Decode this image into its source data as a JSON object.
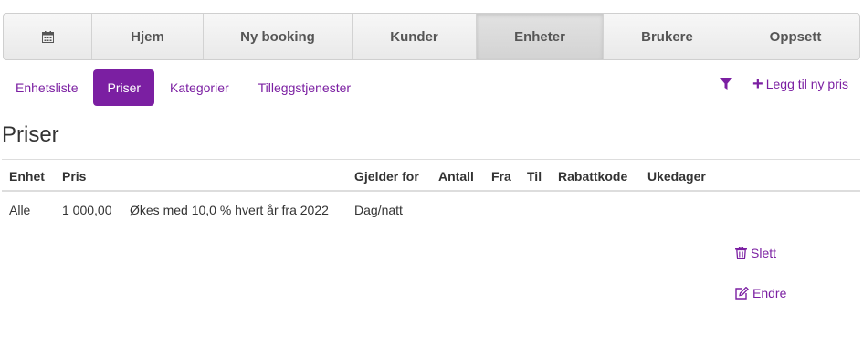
{
  "nav": {
    "items": [
      {
        "label": ""
      },
      {
        "label": "Hjem"
      },
      {
        "label": "Ny booking"
      },
      {
        "label": "Kunder"
      },
      {
        "label": "Enheter"
      },
      {
        "label": "Brukere"
      },
      {
        "label": "Oppsett"
      }
    ],
    "active": "Enheter"
  },
  "subtabs": [
    {
      "label": "Enhetsliste"
    },
    {
      "label": "Priser"
    },
    {
      "label": "Kategorier"
    },
    {
      "label": "Tilleggstjenester"
    }
  ],
  "actions": {
    "filter_icon": "filter-icon",
    "add_label": "Legg til ny pris"
  },
  "page": {
    "title": "Priser"
  },
  "table": {
    "headers": {
      "unit": "Enhet",
      "price": "Pris",
      "applies": "Gjelder for",
      "count": "Antall",
      "from": "Fra",
      "to": "Til",
      "code": "Rabattkode",
      "weekdays": "Ukedager"
    },
    "rows": [
      {
        "unit": "Alle",
        "price": "1 000,00",
        "note": "Økes med 10,0 % hvert år fra 2022",
        "applies": "Dag/natt",
        "delete_label": "Slett",
        "edit_label": "Endre"
      }
    ]
  },
  "colors": {
    "accent": "#7b1fa2"
  }
}
